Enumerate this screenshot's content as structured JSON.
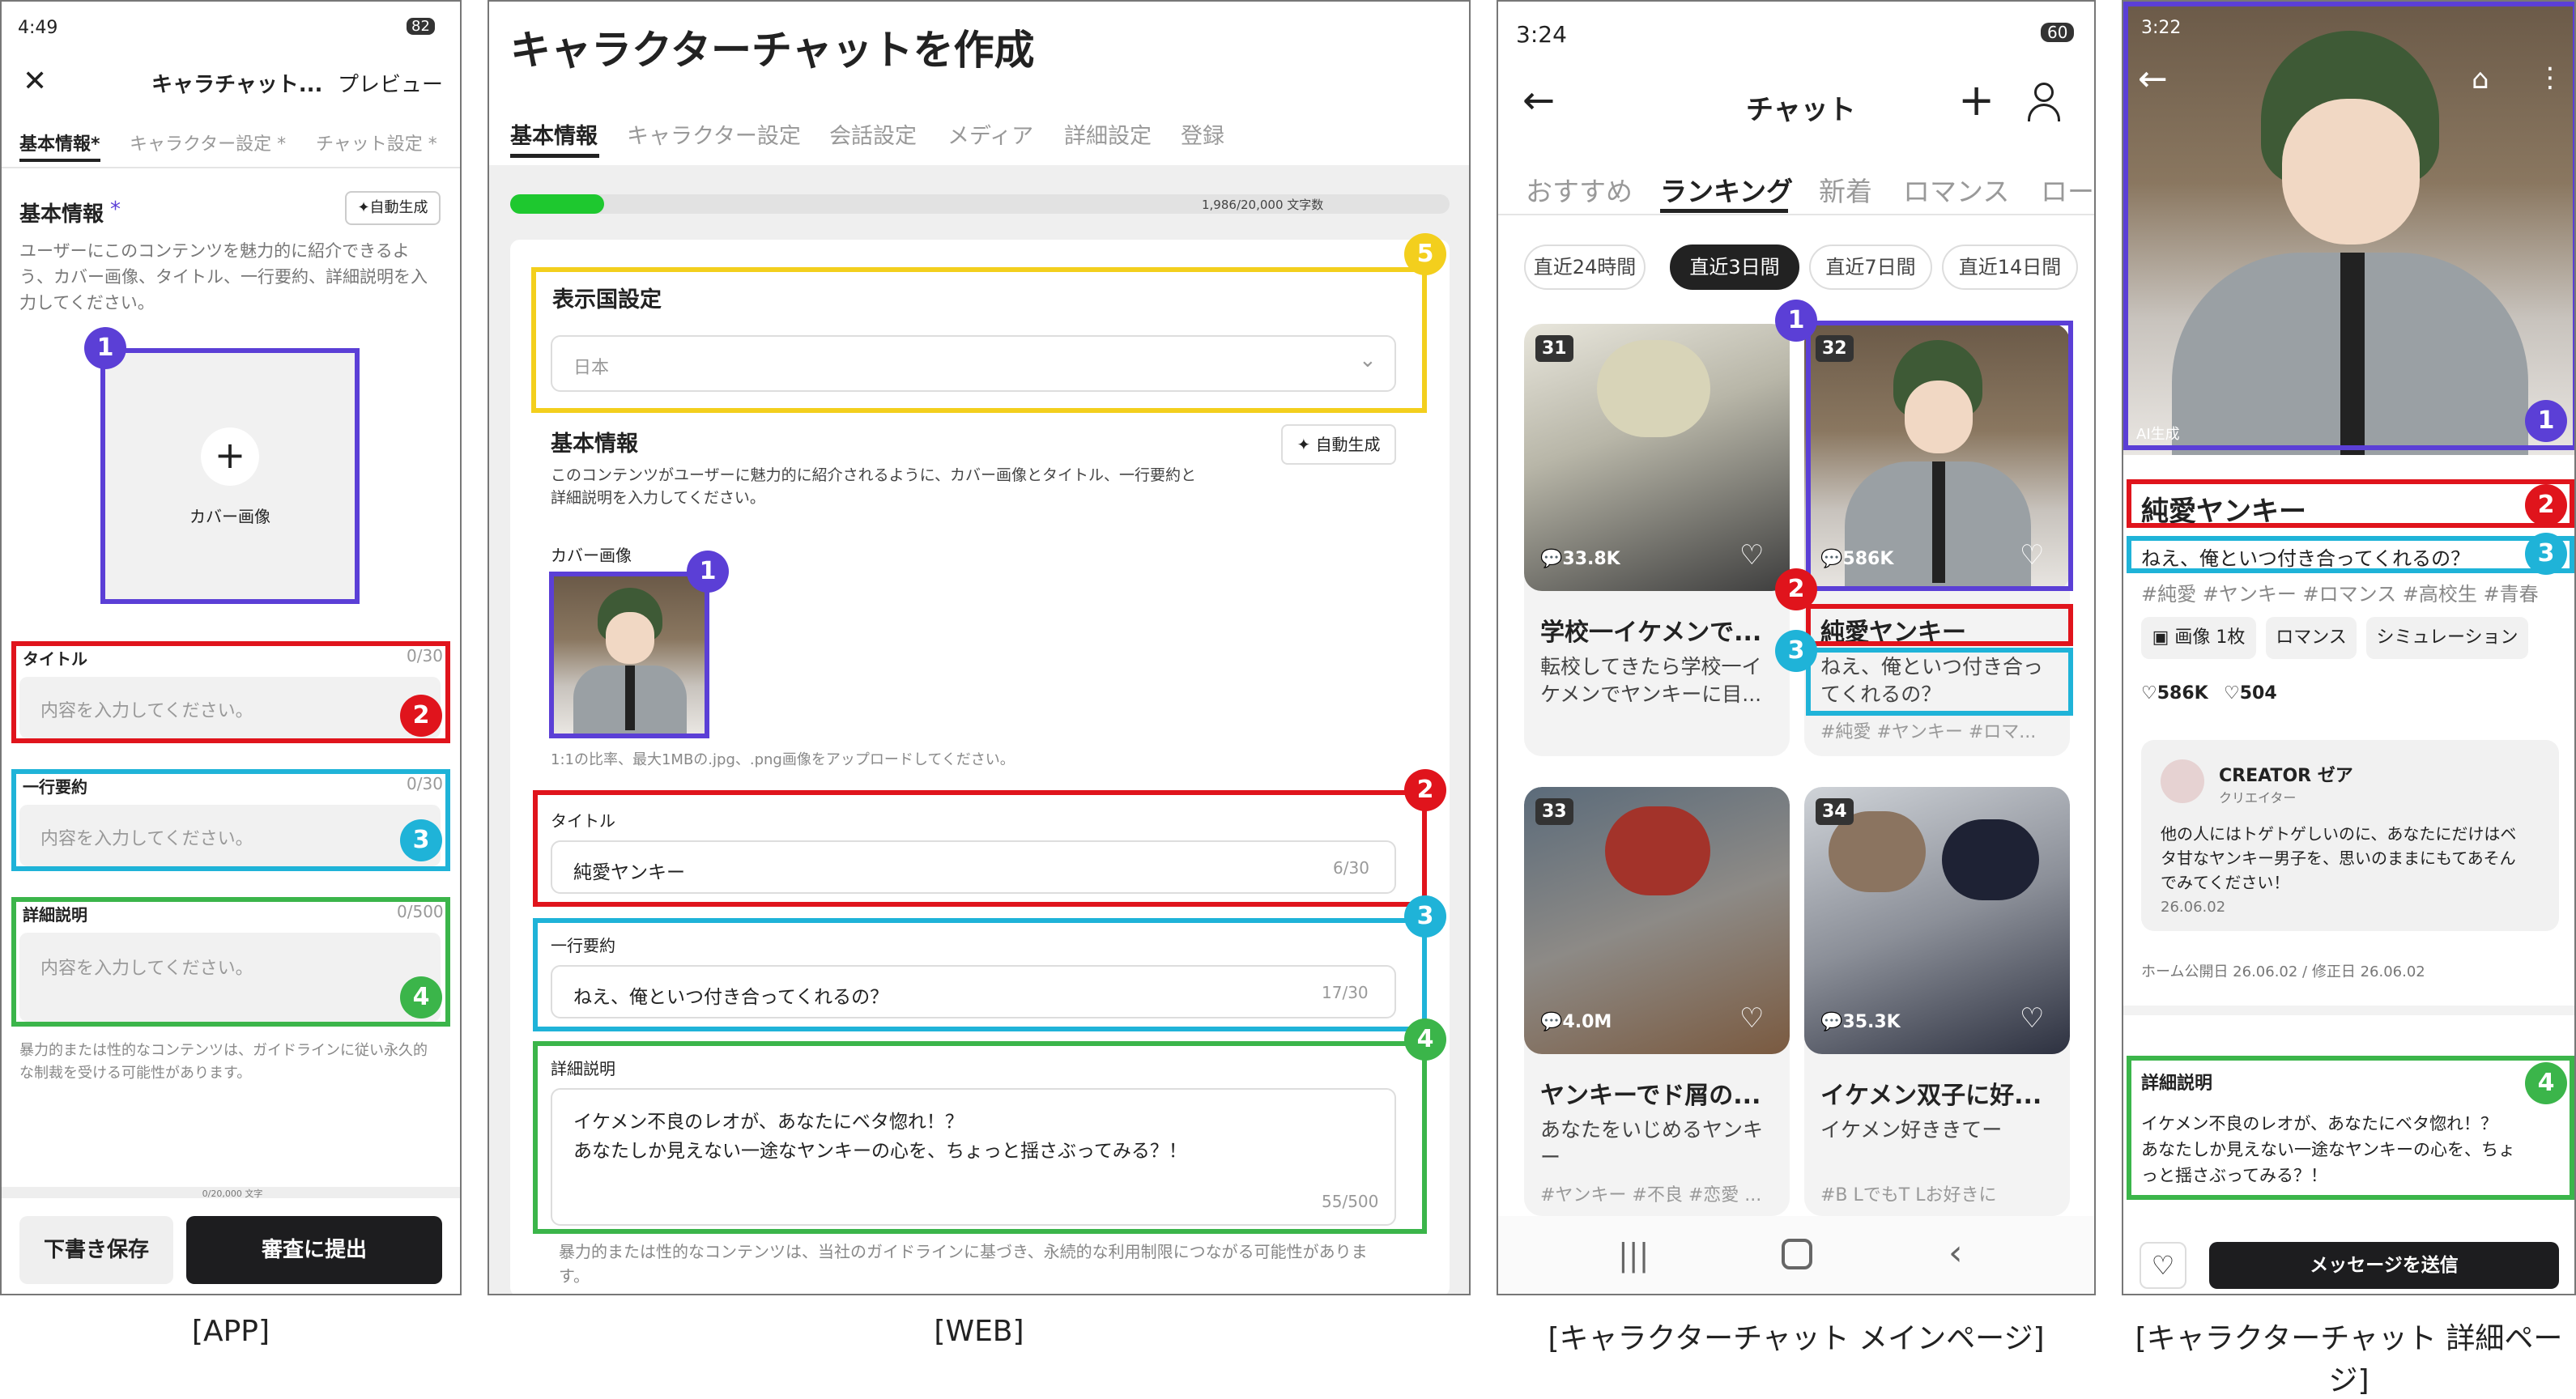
{
  "captions": {
    "app": "[APP]",
    "web": "[WEB]",
    "main": "[キャラクターチャット メインページ]",
    "detail": "[キャラクターチャット 詳細ページ]"
  },
  "markers": {
    "one": "1",
    "two": "2",
    "three": "3",
    "four": "4",
    "five": "5"
  },
  "app": {
    "time": "4:49",
    "battery": "82",
    "header_title": "キャラチャット...",
    "preview": "プレビュー",
    "tabs": [
      "基本情報*",
      "キャラクター設定 *",
      "チャット設定 *"
    ],
    "section_title": "基本情報",
    "section_star": "*",
    "auto": "自動生成",
    "desc": "ユーザーにこのコンテンツを魅力的に紹介できるよう、カバー画像、タイトル、一行要約、詳細説明を入力してください。",
    "cover_label": "カバー画像",
    "title_label": "タイトル",
    "title_count": "0/30",
    "title_ph": "内容を入力してください。",
    "summary_label": "一行要約",
    "summary_count": "0/30",
    "summary_ph": "内容を入力してください。",
    "detail_label": "詳細説明",
    "detail_count": "0/500",
    "detail_ph": "内容を入力してください。",
    "warning": "暴力的または性的なコンテンツは、ガイドラインに従い永久的な制裁を受ける可能性があります。",
    "total": "0/20,000 文字",
    "save": "下書き保存",
    "submit": "審査に提出"
  },
  "web": {
    "title": "キャラクターチャットを作成",
    "tabs": [
      "基本情報",
      "キャラクター設定",
      "会話設定",
      "メディア",
      "詳細設定",
      "登録"
    ],
    "progress_pct": 10,
    "progress_text": "1,986/20,000 文字数",
    "country_label": "表示国設定",
    "country_value": "日本",
    "basic_title": "基本情報",
    "auto": "自動生成",
    "basic_desc1": "このコンテンツがユーザーに魅力的に紹介されるように、カバー画像とタイトル、一行要約と",
    "basic_desc2": "詳細説明を入力してください。",
    "cover_label": "カバー画像",
    "cover_hint": "1:1の比率、最大1MBの.jpg、.png画像をアップロードしてください。",
    "title_label": "タイトル",
    "title_value": "純愛ヤンキー",
    "title_count": "6/30",
    "summary_label": "一行要約",
    "summary_value": "ねえ、俺といつ付き合ってくれるの？",
    "summary_count": "17/30",
    "detail_label": "詳細説明",
    "detail_line1": "イケメン不良のレオが、あなたにベタ惚れ！？",
    "detail_line2": "あなたしか見えない一途なヤンキーの心を、ちょっと揺さぶってみる？！",
    "detail_count": "55/500",
    "warning1": "暴力的または性的なコンテンツは、当社のガイドラインに基づき、永続的な利用制限につながる可能性がありま",
    "warning2": "す。"
  },
  "main": {
    "time": "3:24",
    "battery": "60",
    "title": "チャット",
    "tabs": [
      "おすすめ",
      "ランキング",
      "新着",
      "ロマンス",
      "ロー"
    ],
    "filters": [
      "直近24時間",
      "直近3日間",
      "直近7日間",
      "直近14日間"
    ],
    "cards": [
      {
        "rank": "31",
        "metric": "33.8K",
        "title": "学校一イケメンで...",
        "desc1": "転校してきたら学校一イ",
        "desc2": "ケメンでヤンキーに目..."
      },
      {
        "rank": "32",
        "metric": "586K",
        "title": "純愛ヤンキー",
        "desc1": "ねえ、俺といつ付き合っ",
        "desc2": "てくれるの？",
        "tags": "#純愛 #ヤンキー #ロマ..."
      },
      {
        "rank": "33",
        "metric": "4.0M",
        "title": "ヤンキーでド屑の...",
        "desc1": "あなたをいじめるヤンキ",
        "desc2": "ー",
        "tags": "#ヤンキー #不良 #恋愛 ..."
      },
      {
        "rank": "34",
        "metric": "35.3K",
        "title": "イケメン双子に好...",
        "desc1": "イケメン好ききてー",
        "desc2": "",
        "tags": "#B LでもT Lお好きに"
      }
    ]
  },
  "detail": {
    "time": "3:22",
    "ai": "AI生成",
    "title": "純愛ヤンキー",
    "summary": "ねえ、俺といつ付き合ってくれるの？",
    "tags": "#純愛 #ヤンキー #ロマンス #高校生 #青春",
    "chips": [
      "画像 1枚",
      "ロマンス",
      "シミュレーション"
    ],
    "views": "586K",
    "likes": "504",
    "creator": "CREATOR ゼア",
    "creator_role": "クリエイター",
    "creator_msg1": "他の人にはトゲトゲしいのに、あなたにだけはベ",
    "creator_msg2": "タ甘なヤンキー男子を、思いのままにもてあそん",
    "creator_msg3": "でみてください！",
    "creator_date": "26.06.02",
    "dates": "ホーム公開日 26.06.02 / 修正日 26.06.02",
    "detail_label": "詳細説明",
    "detail_line1": "イケメン不良のレオが、あなたにベタ惚れ！？",
    "detail_line2": "あなたしか見えない一途なヤンキーの心を、ちょ",
    "detail_line3": "っと揺さぶってみる？！",
    "send": "メッセージを送信"
  }
}
